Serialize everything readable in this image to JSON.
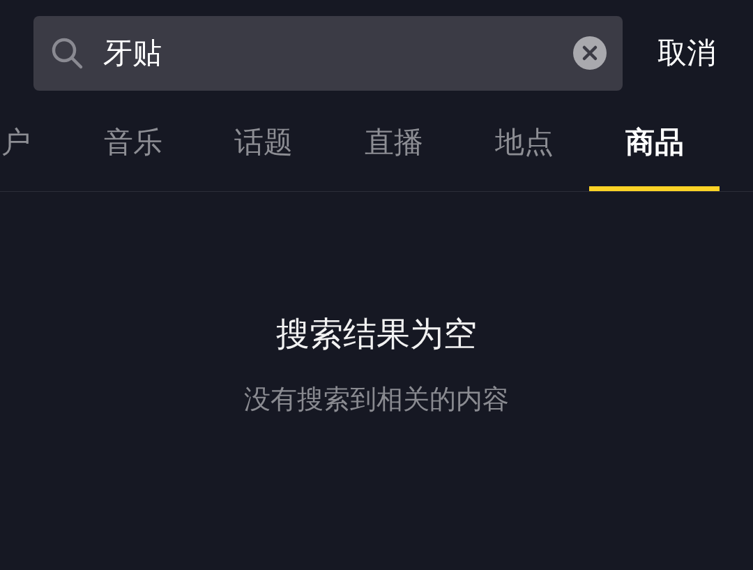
{
  "search": {
    "value": "牙贴",
    "cancel": "取消"
  },
  "tabs": [
    {
      "label": "户",
      "selected": false
    },
    {
      "label": "音乐",
      "selected": false
    },
    {
      "label": "话题",
      "selected": false
    },
    {
      "label": "直播",
      "selected": false
    },
    {
      "label": "地点",
      "selected": false
    },
    {
      "label": "商品",
      "selected": true
    }
  ],
  "empty_state": {
    "title": "搜索结果为空",
    "message": "没有搜索到相关的内容"
  }
}
